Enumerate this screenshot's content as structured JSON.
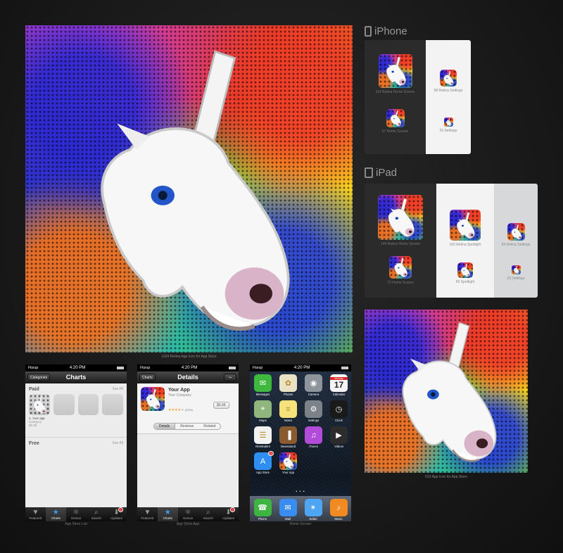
{
  "captions": {
    "large_art": "1024 Retina App Icon for App Store",
    "small_art": "512 App Icon for App Store",
    "charts_phone": "App Store List",
    "details_phone": "App Store App",
    "home_phone": "Home Screen"
  },
  "iphone": {
    "title": "iPhone",
    "labels": {
      "retina_home": "114 Retina Home Screen",
      "retina_settings": "58 Retina Settings",
      "home": "57 Home Screen",
      "settings": "29 Settings"
    }
  },
  "ipad": {
    "title": "iPad",
    "labels": {
      "retina_home": "144 Retina Home Screen",
      "home": "72 Home Screen",
      "retina_spotlight": "100 Retina Spotlight",
      "spotlight": "50 Spotlight",
      "retina_settings": "58 Retina Settings",
      "settings": "29 Settings"
    }
  },
  "status": {
    "carrier": "Flarup",
    "time": "4:20 PM"
  },
  "charts_screen": {
    "nav_title": "Charts",
    "left_button": "Categories",
    "paid_label": "Paid",
    "free_label": "Free",
    "see_all": "See All",
    "app_name": "1. Your app",
    "app_category": "Category",
    "app_price": "$0.99"
  },
  "details_screen": {
    "nav_title": "Details",
    "app_name": "Your App",
    "company": "Your Company",
    "rating_count": "(2001)",
    "price": "$0.99",
    "segments": [
      "Details",
      "Reviews",
      "Related"
    ]
  },
  "tabs": [
    {
      "label": "Featured",
      "icon": "featured-icon",
      "glyph": "▼"
    },
    {
      "label": "Charts",
      "icon": "charts-star-icon",
      "glyph": "★"
    },
    {
      "label": "Genius",
      "icon": "genius-icon",
      "glyph": "⚛"
    },
    {
      "label": "Search",
      "icon": "search-icon",
      "glyph": "⌕"
    },
    {
      "label": "Updates",
      "icon": "updates-icon",
      "glyph": "⬇",
      "badge": "2"
    }
  ],
  "home_screen": {
    "apps": [
      {
        "label": "Messages",
        "icon": "messages-icon",
        "color": "#3fb83d",
        "glyph": "✉"
      },
      {
        "label": "Photos",
        "icon": "photos-icon",
        "color": "#e9e2c5",
        "glyph": "✿"
      },
      {
        "label": "Camera",
        "icon": "camera-icon",
        "color": "#8e949c",
        "glyph": "◉"
      },
      {
        "label": "Calendar",
        "icon": "calendar-icon",
        "color": "#f5f5f5",
        "glyph": "17",
        "sub": "Monday"
      },
      {
        "label": "Maps",
        "icon": "maps-icon",
        "color": "#8fb77d",
        "glyph": "⌖"
      },
      {
        "label": "Notes",
        "icon": "notes-icon",
        "color": "#f6e27a",
        "glyph": "≡"
      },
      {
        "label": "Settings",
        "icon": "settings-gear-icon",
        "color": "#7d8289",
        "glyph": "⚙"
      },
      {
        "label": "Clock",
        "icon": "clock-icon",
        "color": "#1a1a1a",
        "glyph": "◷"
      },
      {
        "label": "Reminders",
        "icon": "reminders-icon",
        "color": "#f2f2f2",
        "glyph": "☰"
      },
      {
        "label": "Newsstand",
        "icon": "newsstand-icon",
        "color": "#8a5a31",
        "glyph": "▐"
      },
      {
        "label": "iTunes",
        "icon": "itunes-icon",
        "color": "#b24bd9",
        "glyph": "♫"
      },
      {
        "label": "Videos",
        "icon": "videos-icon",
        "color": "#2c2c2c",
        "glyph": "▶"
      },
      {
        "label": "App Store",
        "icon": "app-store-icon",
        "color": "#2f8ff0",
        "glyph": "A",
        "badge": "23"
      },
      {
        "label": "Your App",
        "icon": "your-app-icon",
        "color": "art",
        "glyph": ""
      }
    ],
    "dock": [
      {
        "label": "Phone",
        "icon": "phone-icon",
        "color": "#3eb443",
        "glyph": "☎"
      },
      {
        "label": "Mail",
        "icon": "mail-icon",
        "color": "#3a8df0",
        "glyph": "✉"
      },
      {
        "label": "Safari",
        "icon": "safari-icon",
        "color": "#4ea6f2",
        "glyph": "✴"
      },
      {
        "label": "Music",
        "icon": "music-icon",
        "color": "#f08a21",
        "glyph": "♪"
      }
    ],
    "page_dots": "• • •"
  }
}
